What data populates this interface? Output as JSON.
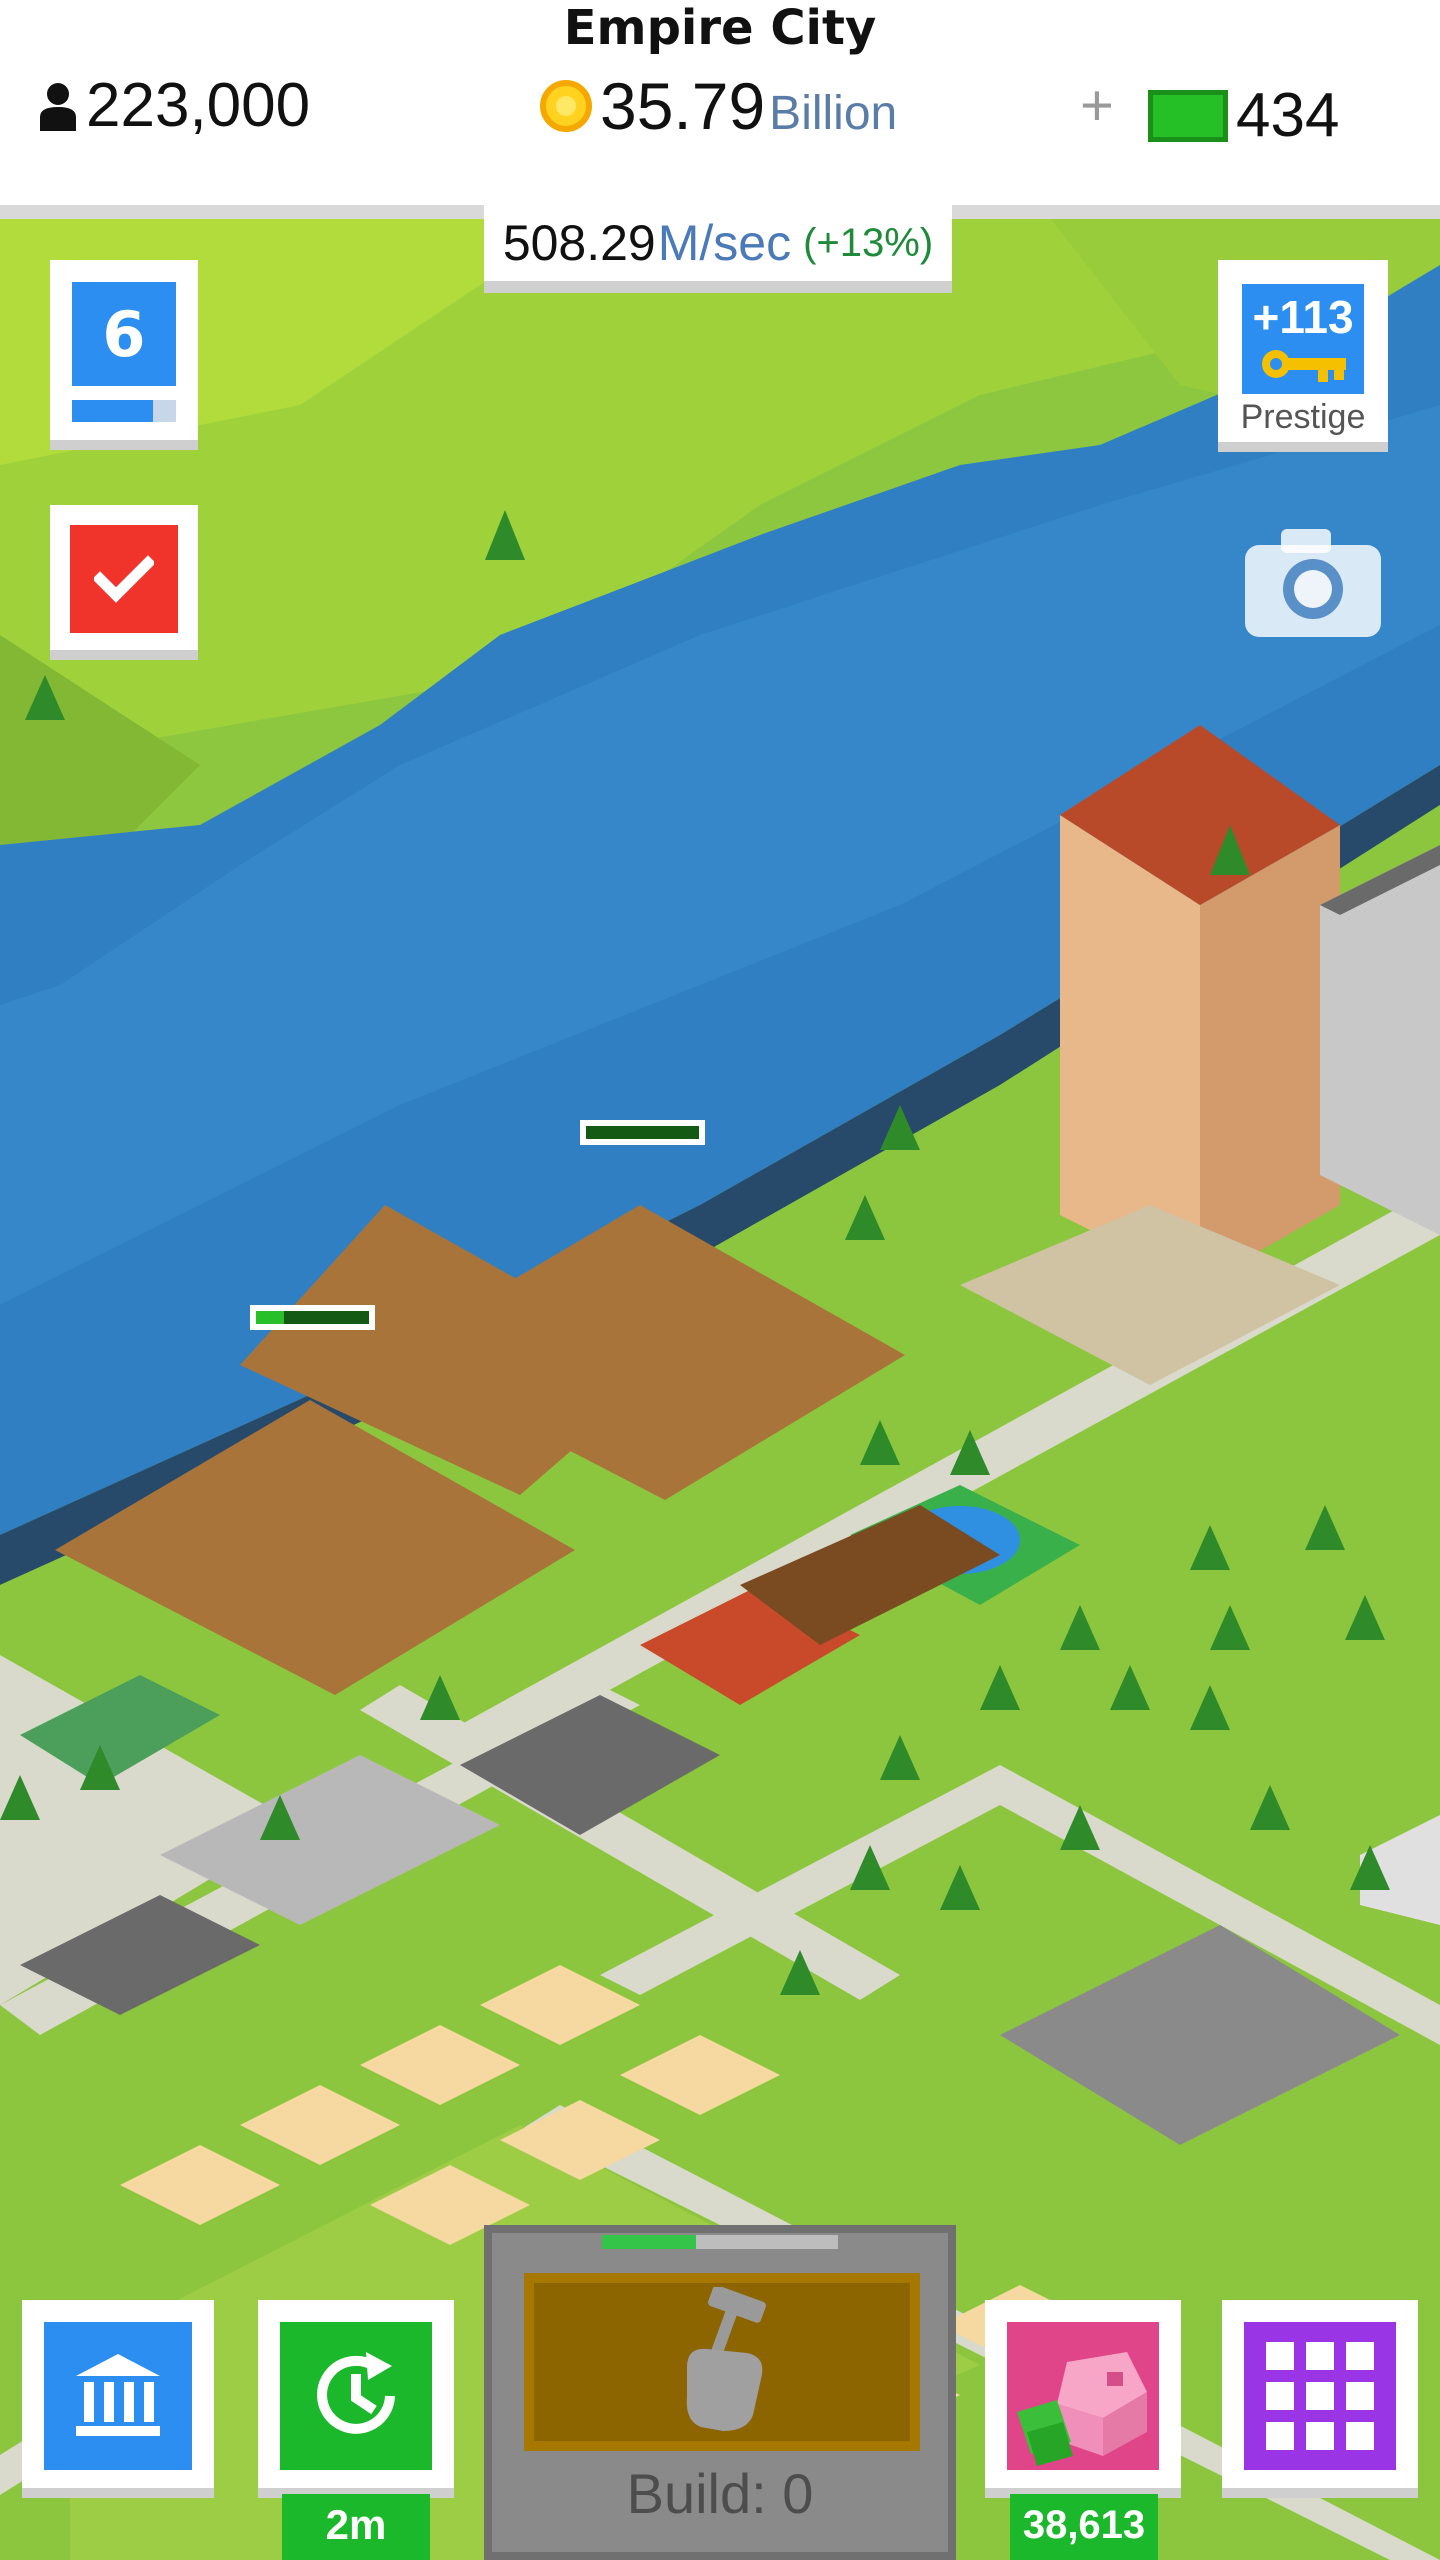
{
  "header": {
    "city_name": "Empire City",
    "population": "223,000",
    "money_value": "35.79",
    "money_unit": "Billion",
    "plus_symbol": "+",
    "cash_value": "434"
  },
  "income": {
    "rate_value": "508.29",
    "rate_unit": "M/sec",
    "rate_bonus": "(+13%)"
  },
  "hud": {
    "level": "6",
    "level_progress": 0.78,
    "prestige_value": "+113",
    "prestige_label": "Prestige"
  },
  "bottom_bar": {
    "boost_label": "2m",
    "build_label": "Build: 0",
    "build_progress": 0.4,
    "bank_value": "38,613"
  },
  "icons": [
    "person-icon",
    "coin-icon",
    "cash-bill-icon",
    "checkmark-icon",
    "key-icon",
    "camera-icon",
    "bank-building-icon",
    "clock-refresh-icon",
    "hammer-hand-icon",
    "piggy-bank-icon",
    "grid-menu-icon"
  ],
  "colors": {
    "accent_blue": "#2b8ef0",
    "task_red": "#f0342c",
    "boost_green": "#1cb82c",
    "menu_purple": "#9a35e6",
    "water": "#2f7fc2",
    "grass": "#8dc63f"
  }
}
